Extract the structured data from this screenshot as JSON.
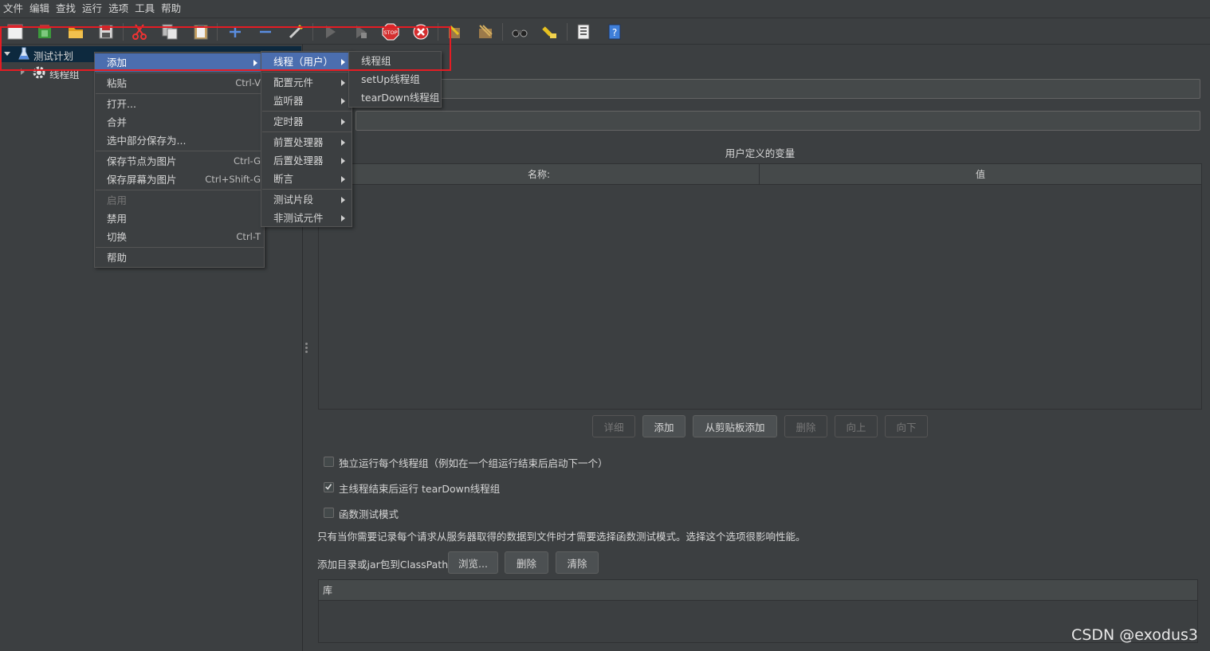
{
  "menubar": [
    "文件",
    "编辑",
    "查找",
    "运行",
    "选项",
    "工具",
    "帮助"
  ],
  "toolbar_icons": [
    "new-icon",
    "templates-icon",
    "open-icon",
    "save-icon",
    "cut-icon",
    "copy-icon",
    "paste-icon",
    "expand-icon",
    "collapse-icon",
    "toggle-icon",
    "start-icon",
    "start-no-pause-icon",
    "stop-icon",
    "shutdown-icon",
    "clear-icon",
    "clear-all-icon",
    "search-icon",
    "reset-search-icon",
    "function-helper-icon",
    "help-icon"
  ],
  "tree": {
    "plan_label": "测试计划",
    "thread_group_label": "线程组"
  },
  "context_menu": {
    "items": [
      {
        "label": "添加",
        "shortcut": "",
        "submenu": true,
        "selected": true
      },
      {
        "label": "粘贴",
        "shortcut": "Ctrl-V"
      },
      {
        "label": "打开...",
        "shortcut": ""
      },
      {
        "label": "合并",
        "shortcut": ""
      },
      {
        "label": "选中部分保存为...",
        "shortcut": ""
      },
      {
        "label": "保存节点为图片",
        "shortcut": "Ctrl-G"
      },
      {
        "label": "保存屏幕为图片",
        "shortcut": "Ctrl+Shift-G"
      },
      {
        "label": "启用",
        "shortcut": "",
        "disabled": true
      },
      {
        "label": "禁用",
        "shortcut": ""
      },
      {
        "label": "切换",
        "shortcut": "Ctrl-T"
      },
      {
        "label": "帮助",
        "shortcut": ""
      }
    ]
  },
  "add_submenu": {
    "items": [
      "线程（用户）",
      "配置元件",
      "监听器",
      "定时器",
      "前置处理器",
      "后置处理器",
      "断言",
      "测试片段",
      "非测试元件"
    ]
  },
  "thread_submenu": {
    "items": [
      "线程组",
      "setUp线程组",
      "tearDown线程组"
    ]
  },
  "right_panel": {
    "vars_title": "用户定义的变量",
    "col_name": "名称:",
    "col_value": "值",
    "buttons": {
      "detail": "详细",
      "add": "添加",
      "add_clipboard": "从剪贴板添加",
      "delete": "删除",
      "up": "向上",
      "down": "向下"
    },
    "checkbox_independent": "独立运行每个线程组（例如在一个组运行结束后启动下一个）",
    "checkbox_teardown": "主线程结束后运行 tearDown线程组",
    "checkbox_functional": "函数测试模式",
    "functional_note": "只有当你需要记录每个请求从服务器取得的数据到文件时才需要选择函数测试模式。选择这个选项很影响性能。",
    "classpath_label": "添加目录或jar包到ClassPath",
    "browse": "浏览...",
    "remove": "删除",
    "clear": "清除",
    "lib_header": "库"
  },
  "checkbox_states": {
    "independent": false,
    "teardown": true,
    "functional": false
  },
  "watermark": "CSDN @exodus3",
  "colors": {
    "background": "#3c3f41",
    "selection": "#4b6eaf",
    "highlight_box": "#e51c23"
  }
}
